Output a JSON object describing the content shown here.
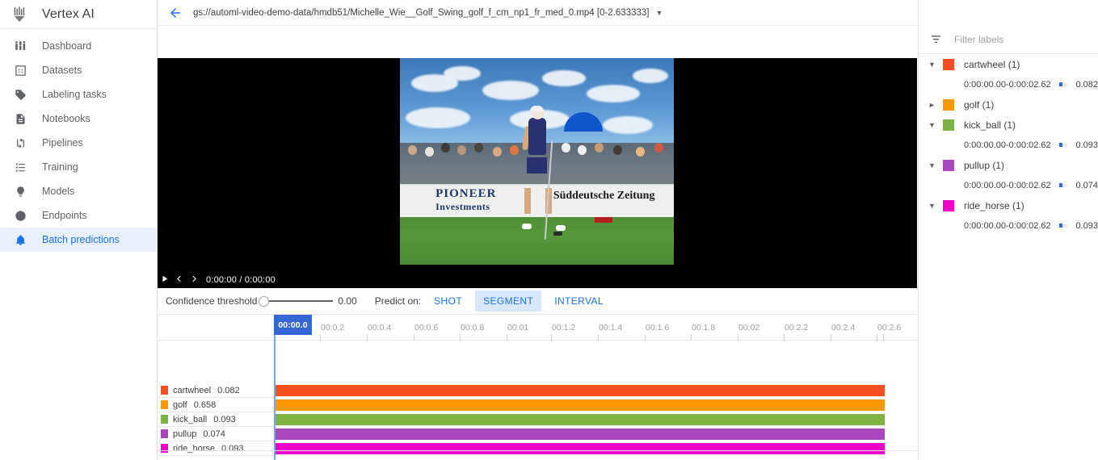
{
  "brand": {
    "name": "Vertex AI",
    "logo_icon": "vertex-ai-logo"
  },
  "sidebar": {
    "items": [
      {
        "label": "Dashboard",
        "icon": "dashboard-icon",
        "active": false
      },
      {
        "label": "Datasets",
        "icon": "datasets-icon",
        "active": false
      },
      {
        "label": "Labeling tasks",
        "icon": "tag-icon",
        "active": false
      },
      {
        "label": "Notebooks",
        "icon": "notebook-icon",
        "active": false
      },
      {
        "label": "Pipelines",
        "icon": "pipelines-icon",
        "active": false
      },
      {
        "label": "Training",
        "icon": "list-icon",
        "active": false
      },
      {
        "label": "Models",
        "icon": "lightbulb-icon",
        "active": false
      },
      {
        "label": "Endpoints",
        "icon": "target-icon",
        "active": false
      },
      {
        "label": "Batch predictions",
        "icon": "bell-icon",
        "active": true
      }
    ]
  },
  "topbar": {
    "back_icon": "back-arrow-icon",
    "path": "gs://automl-video-demo-data/hmdb51/Michelle_Wie__Golf_Swing_golf_f_cm_np1_fr_med_0.mp4 [0-2.633333]",
    "caret_icon": "chevron-down-icon"
  },
  "player": {
    "play_icon": "play-icon",
    "prev_icon": "previous-frame-icon",
    "next_icon": "next-frame-icon",
    "time_display": "0:00:00 / 0:00:00"
  },
  "controls": {
    "threshold_label": "Confidence threshold",
    "threshold_value": "0.00",
    "predict_on_label": "Predict on:",
    "modes": [
      {
        "label": "SHOT",
        "selected": false
      },
      {
        "label": "SEGMENT",
        "selected": true
      },
      {
        "label": "INTERVAL",
        "selected": false
      }
    ]
  },
  "timeline": {
    "playhead_label": "00:00.0",
    "ticks": [
      "00:0.2",
      "00:0.4",
      "00:0.6",
      "00:0.8",
      "00:01",
      "00:1.2",
      "00:1.4",
      "00:1.6",
      "00:1.8",
      "00:02",
      "00:2.2",
      "00:2.4",
      "00:2.6"
    ],
    "tracks": [
      {
        "name": "cartwheel",
        "score": "0.082",
        "color": "#f4511e"
      },
      {
        "name": "golf",
        "score": "0.658",
        "color": "#fb9800"
      },
      {
        "name": "kick_ball",
        "score": "0.093",
        "color": "#7cb342"
      },
      {
        "name": "pullup",
        "score": "0.074",
        "color": "#ab47bc"
      },
      {
        "name": "ride_horse",
        "score": "0.093",
        "color": "#ef00c8"
      }
    ]
  },
  "right_panel": {
    "filter_icon": "filter-icon",
    "filter_placeholder": "Filter labels",
    "groups": [
      {
        "name": "cartwheel (1)",
        "color": "#f4511e",
        "expanded": true,
        "segments": [
          {
            "range": "0:00:00.00-0:00:02.62",
            "score": "0.082"
          }
        ]
      },
      {
        "name": "golf (1)",
        "color": "#fb9800",
        "expanded": false,
        "segments": []
      },
      {
        "name": "kick_ball (1)",
        "color": "#7cb342",
        "expanded": true,
        "segments": [
          {
            "range": "0:00:00.00-0:00:02.62",
            "score": "0.093"
          }
        ]
      },
      {
        "name": "pullup (1)",
        "color": "#ab47bc",
        "expanded": true,
        "segments": [
          {
            "range": "0:00:00.00-0:00:02.62",
            "score": "0.074"
          }
        ]
      },
      {
        "name": "ride_horse (1)",
        "color": "#ef00c8",
        "expanded": true,
        "segments": [
          {
            "range": "0:00:00.00-0:00:02.62",
            "score": "0.093"
          }
        ]
      }
    ]
  },
  "video": {
    "banner_left_line1": "PIONEER",
    "banner_left_line2": "Investments",
    "banner_right": "Süddeutsche Zeitung"
  },
  "colors": {
    "accent_blue": "#1a73e8",
    "playhead_blue": "#3367d6",
    "selected_chip": "#d9e7fb"
  }
}
